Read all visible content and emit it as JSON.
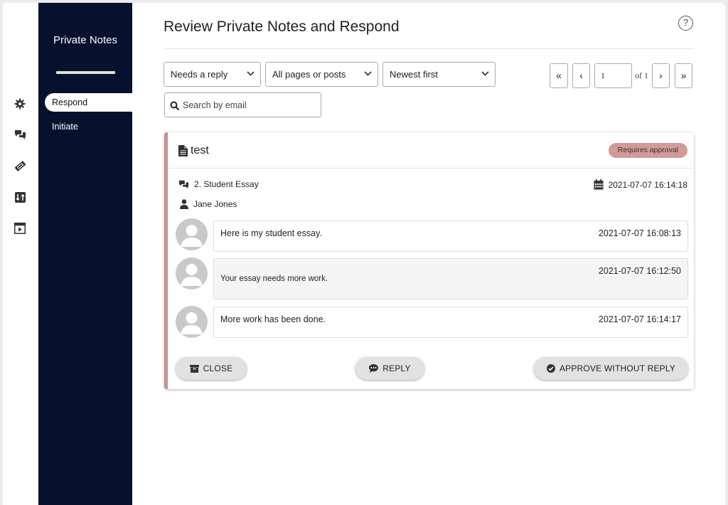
{
  "sidebar": {
    "title": "Private Notes",
    "nav": [
      {
        "label": "Respond",
        "active": true
      },
      {
        "label": "Initiate",
        "active": false
      }
    ]
  },
  "icon_bar": [
    "gear-icon",
    "comments-icon",
    "ticket-icon",
    "sort-icon",
    "video-icon"
  ],
  "header": {
    "title": "Review Private Notes and Respond",
    "help_label": "?"
  },
  "filters": {
    "status": "Needs a reply",
    "scope": "All pages or posts",
    "sort": "Newest first",
    "search_placeholder": "Search by email"
  },
  "pagination": {
    "first": "«",
    "prev": "‹",
    "page": "1",
    "of": "of 1",
    "next": "›",
    "last": "»"
  },
  "note": {
    "title": "test",
    "badge": "Requires approval",
    "page": "2. Student Essay",
    "date": "2021-07-07 16:14:18",
    "author": "Jane Jones",
    "messages": [
      {
        "text": "Here is my student essay.",
        "time": "2021-07-07 16:08:13"
      },
      {
        "text": "Your essay needs more work.",
        "time": "2021-07-07 16:12:50"
      },
      {
        "text": "More work has been done.",
        "time": "2021-07-07 16:14:17"
      }
    ],
    "actions": {
      "close": "CLOSE",
      "reply": "REPLY",
      "approve": "APPROVE WITHOUT REPLY"
    }
  },
  "colors": {
    "sidebar_bg": "#06112e",
    "card_accent": "#c99190",
    "badge_bg": "#d29a99"
  }
}
